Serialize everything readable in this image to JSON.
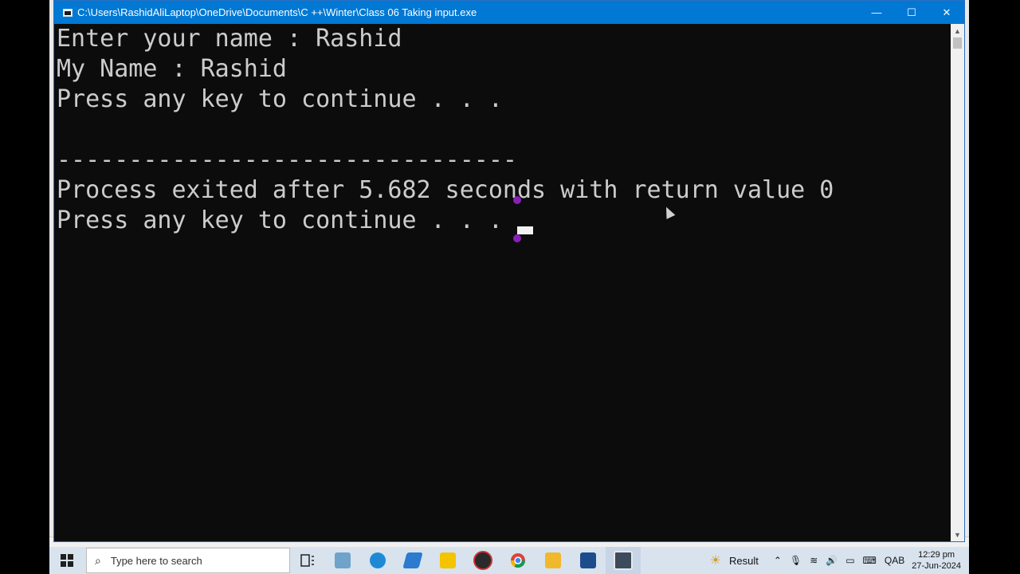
{
  "window": {
    "title": "C:\\Users\\RashidAliLaptop\\OneDrive\\Documents\\C ++\\Winter\\Class 06 Taking input.exe",
    "minimize_glyph": "—",
    "maximize_glyph": "☐",
    "close_glyph": "✕"
  },
  "console": {
    "lines": [
      "Enter your name : Rashid",
      "My Name : Rashid",
      "Press any key to continue . . .",
      "",
      "--------------------------------",
      "Process exited after 5.682 seconds with return value 0",
      "Press any key to continue . . ."
    ]
  },
  "taskbar": {
    "search_placeholder": "Type here to search",
    "result_label": "Result",
    "language": "QAB",
    "time": "12:29 pm",
    "date": "27-Jun-2024",
    "icons": [
      "task-view-icon",
      "app-icon",
      "edge-icon",
      "app-icon-2",
      "sticky-notes-icon",
      "app-icon-3",
      "chrome-icon",
      "file-explorer-icon",
      "dev-cpp-icon",
      "console-app-icon"
    ]
  },
  "colors": {
    "titlebar": "#0078d4",
    "console_bg": "#0c0c0c",
    "console_text": "#cccccc",
    "taskbar": "#d8e3ee"
  }
}
